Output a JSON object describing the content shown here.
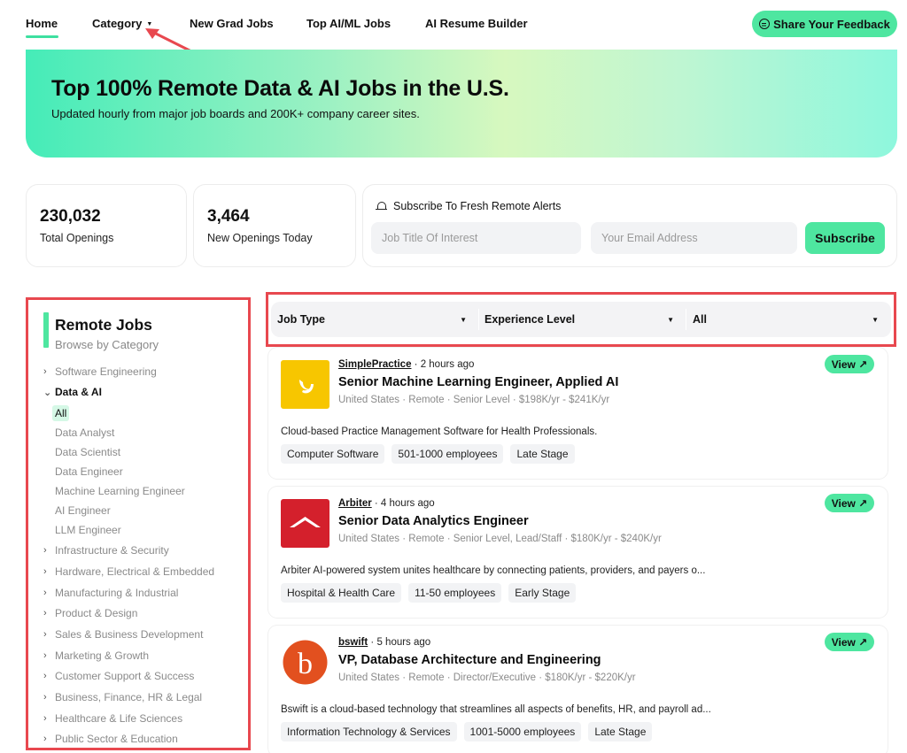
{
  "nav": {
    "home": "Home",
    "category": "Category",
    "new_grad": "New Grad Jobs",
    "top_ai_ml": "Top AI/ML Jobs",
    "resume": "AI Resume Builder",
    "feedback": "Share Your Feedback"
  },
  "hero": {
    "title": "Top 100% Remote Data & AI Jobs in the U.S.",
    "subtitle": "Updated hourly from major job boards and 200K+ company career sites."
  },
  "stats": {
    "total_openings": "230,032",
    "total_label": "Total Openings",
    "new_today": "3,464",
    "new_label": "New Openings Today"
  },
  "subscribe": {
    "title": "Subscribe To Fresh Remote Alerts",
    "job_placeholder": "Job Title Of Interest",
    "email_placeholder": "Your Email Address",
    "button": "Subscribe"
  },
  "sidebar": {
    "title": "Remote Jobs",
    "subtitle": "Browse by Category",
    "categories": [
      "Software Engineering",
      "Data & AI",
      "Infrastructure & Security",
      "Hardware, Electrical & Embedded",
      "Manufacturing & Industrial",
      "Product & Design",
      "Sales & Business Development",
      "Marketing & Growth",
      "Customer Support & Success",
      "Business, Finance, HR & Legal",
      "Healthcare & Life Sciences",
      "Public Sector & Education"
    ],
    "subcategories": [
      "All",
      "Data Analyst",
      "Data Scientist",
      "Data Engineer",
      "Machine Learning Engineer",
      "AI Engineer",
      "LLM Engineer"
    ]
  },
  "filters": {
    "job_type": "Job Type",
    "experience": "Experience Level",
    "all": "All"
  },
  "view_label": "View ↗",
  "jobs": [
    {
      "company": "SimplePractice",
      "posted": " · 2 hours ago",
      "title": "Senior Machine Learning Engineer, Applied AI",
      "meta": "United States · Remote · Senior Level · $198K/yr - $241K/yr",
      "desc": "Cloud-based Practice Management Software for Health Professionals.",
      "tags": [
        "Computer Software",
        "501-1000 employees",
        "Late Stage"
      ],
      "logo_color": "#f7c600"
    },
    {
      "company": "Arbiter",
      "posted": " · 4 hours ago",
      "title": "Senior Data Analytics Engineer",
      "meta": "United States · Remote · Senior Level, Lead/Staff · $180K/yr - $240K/yr",
      "desc": "Arbiter AI-powered system unites healthcare by connecting patients, providers, and payers o...",
      "tags": [
        "Hospital & Health Care",
        "11-50 employees",
        "Early Stage"
      ],
      "logo_color": "#d4202c"
    },
    {
      "company": "bswift",
      "posted": " · 5 hours ago",
      "title": "VP, Database Architecture and Engineering",
      "meta": "United States · Remote · Director/Executive · $180K/yr - $220K/yr",
      "desc": "Bswift is a cloud-based technology that streamlines all aspects of benefits, HR, and payroll ad...",
      "tags": [
        "Information Technology & Services",
        "1001-5000 employees",
        "Late Stage"
      ],
      "logo_color": "#e2501f"
    }
  ]
}
